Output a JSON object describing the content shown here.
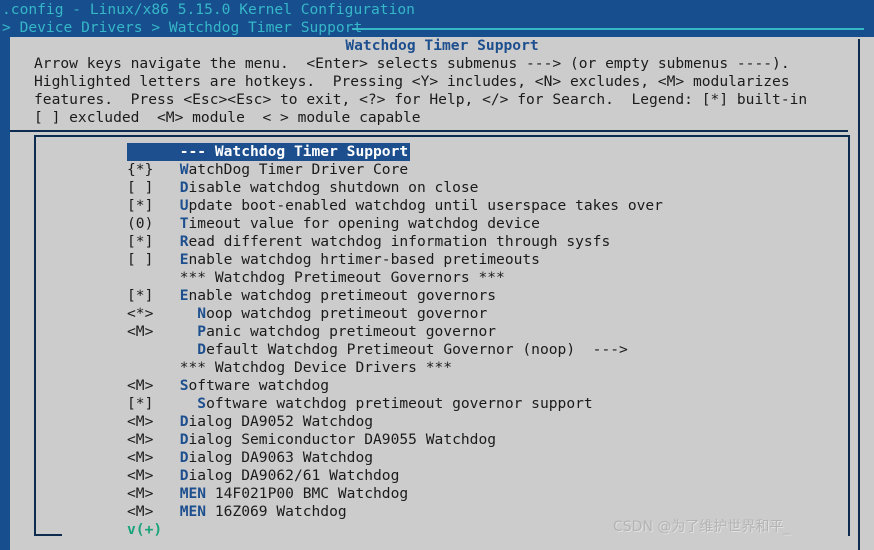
{
  "window": {
    "title": ".config - Linux/x86 5.15.0 Kernel Configuration",
    "breadcrumb": "> Device Drivers > Watchdog Timer Support"
  },
  "help": {
    "heading": "Watchdog Timer Support",
    "lines": [
      "Arrow keys navigate the menu.  <Enter> selects submenus ---> (or empty submenus ----).",
      "Highlighted letters are hotkeys.  Pressing <Y> includes, <N> excludes, <M> modularizes",
      "features.  Press <Esc><Esc> to exit, <?> for Help, </> for Search.  Legend: [*] built-in",
      "[ ] excluded  <M> module  < > module capable"
    ]
  },
  "menu": {
    "scroll_hint": "v(+)",
    "items": [
      {
        "marker": "",
        "indent": 0,
        "hot": "",
        "pre": "--- Watchdog Timer Support",
        "post": "",
        "selected": true,
        "kind": "title"
      },
      {
        "marker": "{*}",
        "indent": 0,
        "hot": "W",
        "pre": "",
        "post": "atchDog Timer Driver Core",
        "selected": false,
        "kind": "option"
      },
      {
        "marker": "[ ]",
        "indent": 0,
        "hot": "D",
        "pre": "",
        "post": "isable watchdog shutdown on close",
        "selected": false,
        "kind": "option"
      },
      {
        "marker": "[*]",
        "indent": 0,
        "hot": "U",
        "pre": "",
        "post": "pdate boot-enabled watchdog until userspace takes over",
        "selected": false,
        "kind": "option"
      },
      {
        "marker": "(0)",
        "indent": 0,
        "hot": "T",
        "pre": "",
        "post": "imeout value for opening watchdog device",
        "selected": false,
        "kind": "option"
      },
      {
        "marker": "[*]",
        "indent": 0,
        "hot": "R",
        "pre": "",
        "post": "ead different watchdog information through sysfs",
        "selected": false,
        "kind": "option"
      },
      {
        "marker": "[ ]",
        "indent": 0,
        "hot": "E",
        "pre": "",
        "post": "nable watchdog hrtimer-based pretimeouts",
        "selected": false,
        "kind": "option"
      },
      {
        "marker": "",
        "indent": 0,
        "hot": "",
        "pre": "*** Watchdog Pretimeout Governors ***",
        "post": "",
        "selected": false,
        "kind": "separator"
      },
      {
        "marker": "[*]",
        "indent": 0,
        "hot": "E",
        "pre": "",
        "post": "nable watchdog pretimeout governors",
        "selected": false,
        "kind": "option"
      },
      {
        "marker": "<*>",
        "indent": 1,
        "hot": "N",
        "pre": "",
        "post": "oop watchdog pretimeout governor",
        "selected": false,
        "kind": "option"
      },
      {
        "marker": "<M>",
        "indent": 1,
        "hot": "P",
        "pre": "",
        "post": "anic watchdog pretimeout governor",
        "selected": false,
        "kind": "option"
      },
      {
        "marker": "",
        "indent": 1,
        "hot": "D",
        "pre": "",
        "post": "efault Watchdog Pretimeout Governor (noop)  --->",
        "selected": false,
        "kind": "submenu"
      },
      {
        "marker": "",
        "indent": 0,
        "hot": "",
        "pre": "*** Watchdog Device Drivers ***",
        "post": "",
        "selected": false,
        "kind": "separator"
      },
      {
        "marker": "<M>",
        "indent": 0,
        "hot": "S",
        "pre": "",
        "post": "oftware watchdog",
        "selected": false,
        "kind": "option"
      },
      {
        "marker": "[*]",
        "indent": 1,
        "hot": "S",
        "pre": "",
        "post": "oftware watchdog pretimeout governor support",
        "selected": false,
        "kind": "option"
      },
      {
        "marker": "<M>",
        "indent": 0,
        "hot": "D",
        "pre": "",
        "post": "ialog DA9052 Watchdog",
        "selected": false,
        "kind": "option"
      },
      {
        "marker": "<M>",
        "indent": 0,
        "hot": "D",
        "pre": "",
        "post": "ialog Semiconductor DA9055 Watchdog",
        "selected": false,
        "kind": "option"
      },
      {
        "marker": "<M>",
        "indent": 0,
        "hot": "D",
        "pre": "",
        "post": "ialog DA9063 Watchdog",
        "selected": false,
        "kind": "option"
      },
      {
        "marker": "<M>",
        "indent": 0,
        "hot": "D",
        "pre": "",
        "post": "ialog DA9062/61 Watchdog",
        "selected": false,
        "kind": "option"
      },
      {
        "marker": "<M>",
        "indent": 0,
        "hot": "MEN",
        "pre": "",
        "post": " 14F021P00 BMC Watchdog",
        "selected": false,
        "kind": "option"
      },
      {
        "marker": "<M>",
        "indent": 0,
        "hot": "MEN",
        "pre": "",
        "post": " 16Z069 Watchdog",
        "selected": false,
        "kind": "option"
      }
    ]
  },
  "watermark": {
    "text": "CSDN @为了维护世界和平_"
  },
  "colors": {
    "desktop_blue": "#174e8e",
    "title_cyan": "#36b7c8",
    "panel_gray": "#cccccc",
    "frame_navy": "#0d2b4e",
    "accent_blue": "#1d4f8f",
    "scroll_green": "#19a37a"
  }
}
